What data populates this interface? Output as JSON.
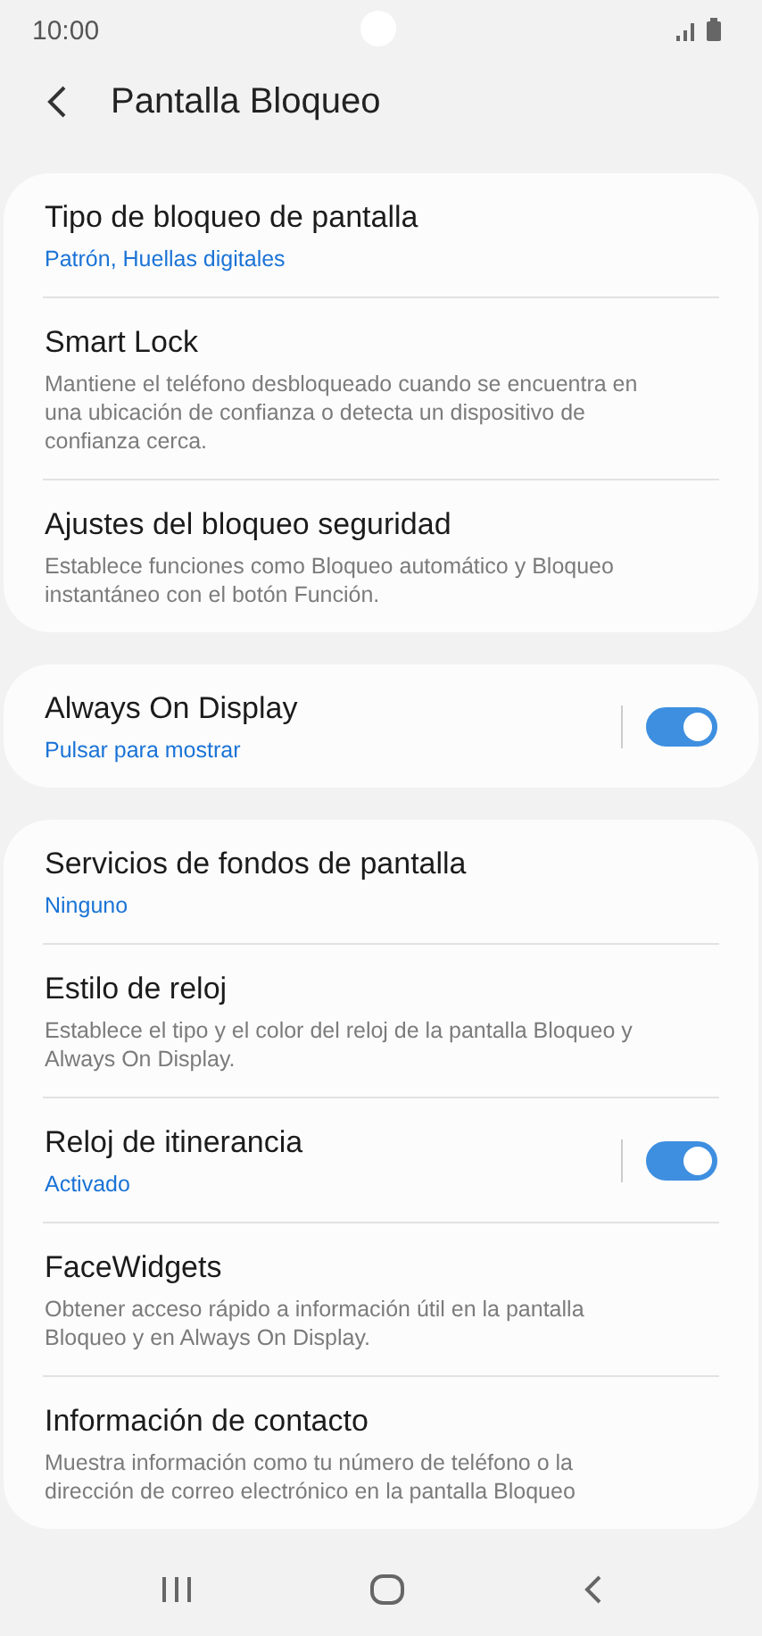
{
  "status_bar": {
    "time": "10:00"
  },
  "header": {
    "title": "Pantalla Bloqueo"
  },
  "groups": [
    {
      "items": [
        {
          "kind": "link",
          "title": "Tipo de bloqueo de pantalla",
          "summary": "Patrón, Huellas digitales",
          "highlighted": true
        },
        {
          "kind": "link",
          "title": "Smart Lock",
          "summary": "Mantiene el teléfono desbloqueado cuando se encuentra en una ubicación de confianza o detecta un dispositivo de confianza cerca.",
          "highlighted": false
        },
        {
          "kind": "link",
          "title": "Ajustes del bloqueo seguridad",
          "summary": "Establece funciones como Bloqueo automático y Bloqueo instantáneo con el botón Función.",
          "highlighted": false
        }
      ]
    },
    {
      "items": [
        {
          "kind": "switch",
          "title": "Always On Display",
          "summary": "Pulsar para mostrar",
          "highlighted": true,
          "on": true
        }
      ]
    },
    {
      "items": [
        {
          "kind": "link",
          "title": "Servicios de fondos de pantalla",
          "summary": "Ninguno",
          "highlighted": true
        },
        {
          "kind": "link",
          "title": "Estilo de reloj",
          "summary": "Establece el tipo y el color del reloj de la pantalla Bloqueo y Always On Display.",
          "highlighted": false
        },
        {
          "kind": "switch",
          "title": "Reloj de itinerancia",
          "summary": "Activado",
          "highlighted": true,
          "on": true
        },
        {
          "kind": "link",
          "title": "FaceWidgets",
          "summary": "Obtener acceso rápido a información útil en la pantalla Bloqueo y en Always On Display.",
          "highlighted": false
        },
        {
          "kind": "link",
          "title": "Información de contacto",
          "summary": "Muestra información como tu número de teléfono o la dirección de correo electrónico en la pantalla Bloqueo",
          "highlighted": false
        }
      ]
    }
  ]
}
